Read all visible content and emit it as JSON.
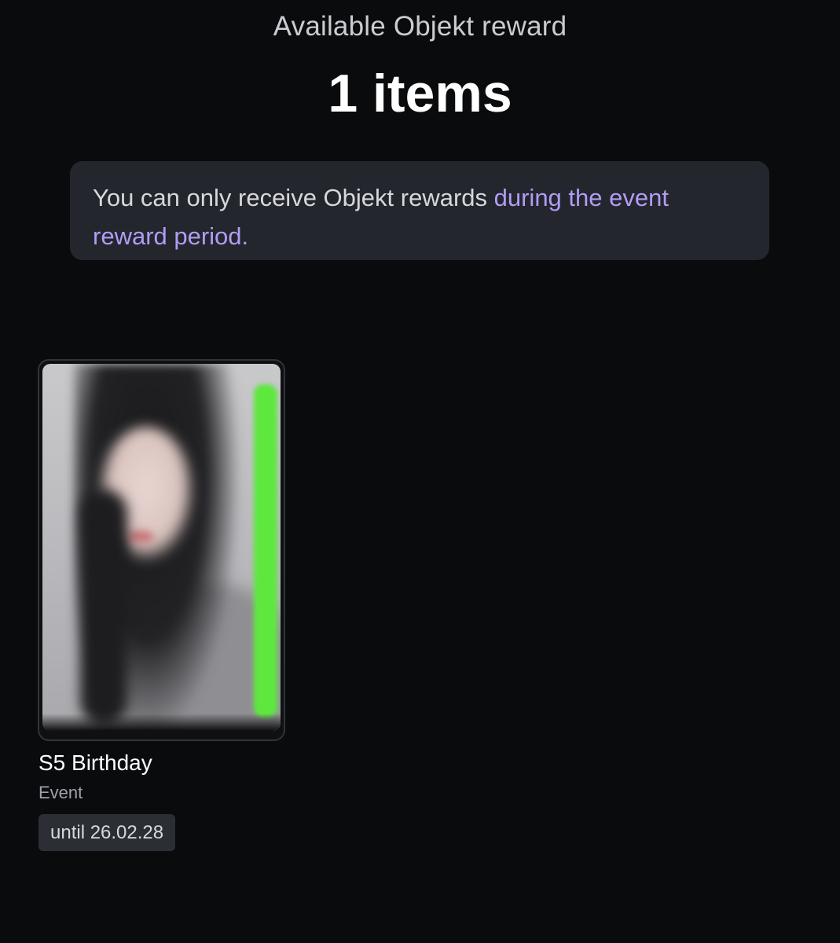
{
  "header": {
    "subtitle": "Available Objekt reward",
    "count_label": "1 items"
  },
  "notice": {
    "text_prefix": "You can only receive Objekt rewards ",
    "text_highlight": "during the event reward period."
  },
  "rewards": [
    {
      "title": "S5 Birthday",
      "type": "Event",
      "badge": "until 26.02.28"
    }
  ],
  "colors": {
    "background": "#0a0b0d",
    "notice_background": "#23262d",
    "highlight": "#b29cf4",
    "card_accent": "#5ee83e"
  }
}
